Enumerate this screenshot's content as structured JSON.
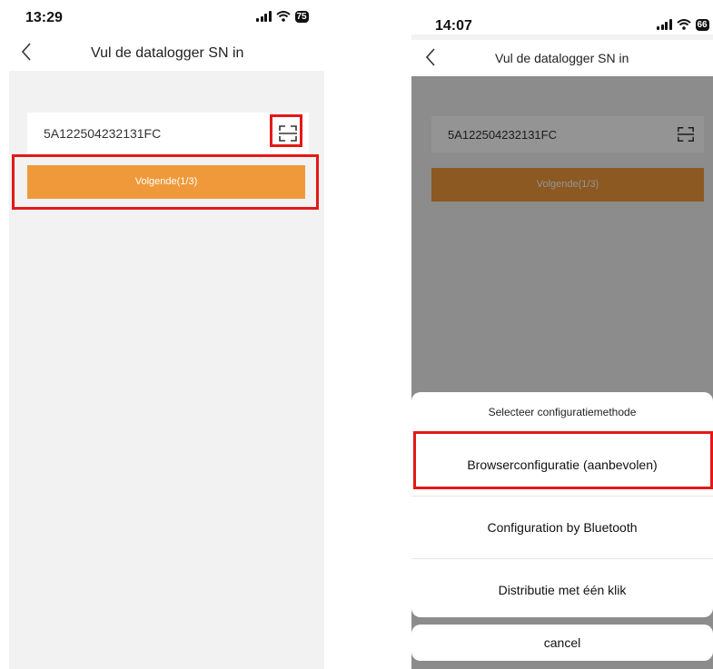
{
  "left": {
    "status_time": "13:29",
    "battery": "75",
    "title": "Vul de datalogger SN in",
    "serial": "5A122504232131FC",
    "next_label": "Volgende(1/3)"
  },
  "right": {
    "status_time": "14:07",
    "battery": "66",
    "title": "Vul de datalogger SN in",
    "serial": "5A122504232131FC",
    "next_label": "Volgende(1/3)",
    "sheet_title": "Selecteer configuratiemethode",
    "options": [
      "Browserconfiguratie (aanbevolen)",
      "Configuration by Bluetooth",
      "Distributie met één klik"
    ],
    "cancel_label": "cancel"
  },
  "colors": {
    "accent_orange": "#f0993a",
    "highlight_red": "#e41818",
    "page_bg": "#f2f2f2"
  },
  "icons": [
    "back-arrow-icon",
    "scan-icon",
    "signal-icon",
    "wifi-icon",
    "battery-icon"
  ]
}
